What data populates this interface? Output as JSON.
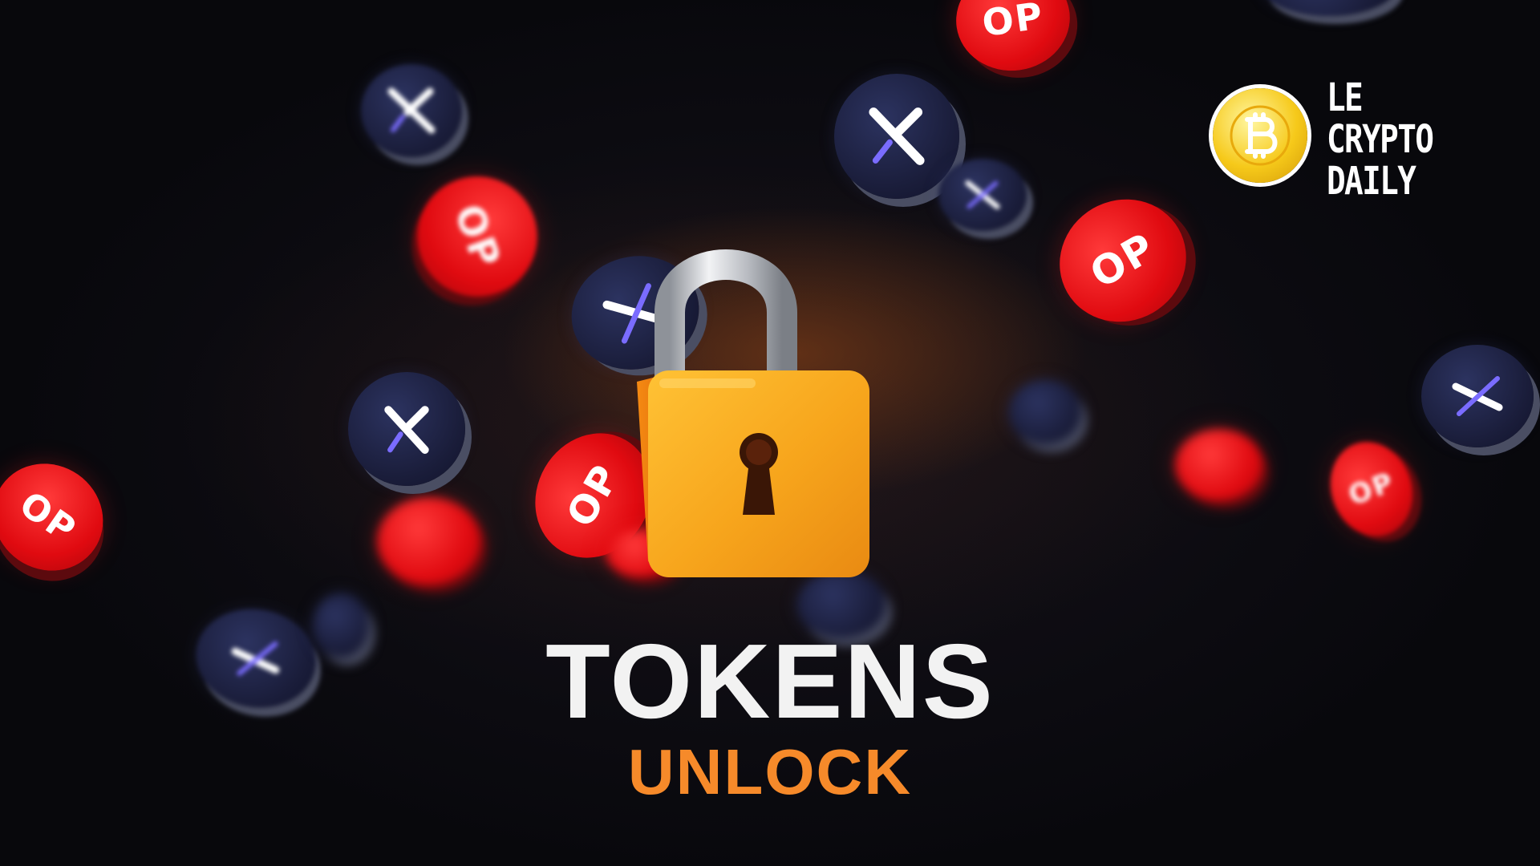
{
  "title": {
    "main": "TOKENS",
    "sub": "UNLOCK"
  },
  "logo": {
    "line1": "LE",
    "line2": "CRYPTO",
    "line3": "DAILY",
    "icon": "bitcoin-icon"
  },
  "coins": {
    "op_label": "OP",
    "op_icon": "optimism-coin-icon",
    "dydx_icon": "dydx-coin-icon"
  },
  "colors": {
    "title_main": "#f2f2f2",
    "title_sub": "#f68a2a",
    "op_red": "#e00a10",
    "dydx_navy": "#1a1d3a",
    "lock_orange": "#f7a51c",
    "logo_gold": "#f6c91a"
  }
}
